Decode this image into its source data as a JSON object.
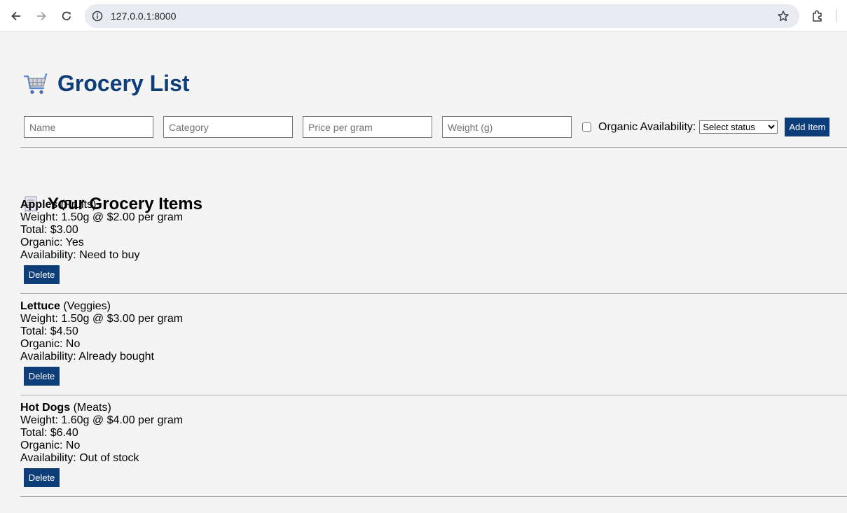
{
  "browser": {
    "url": "127.0.0.1:8000"
  },
  "page": {
    "title": "Grocery List",
    "form": {
      "name_placeholder": "Name",
      "category_placeholder": "Category",
      "price_placeholder": "Price per gram",
      "weight_placeholder": "Weight (g)",
      "organic_label": "Organic",
      "availability_label": "Availability:",
      "status_selected": "Select status",
      "add_button": "Add Item"
    },
    "list_title": "Your Grocery Items",
    "delete_label": "Delete",
    "items": [
      {
        "name": "Apples",
        "category": "(Fruits)",
        "weight_line": "Weight: 1.50g @ $2.00 per gram",
        "total_line": "Total: $3.00",
        "organic_line": "Organic: Yes",
        "availability_line": "Availability: Need to buy"
      },
      {
        "name": "Lettuce",
        "category": "(Veggies)",
        "weight_line": "Weight: 1.50g @ $3.00 per gram",
        "total_line": "Total: $4.50",
        "organic_line": "Organic: No",
        "availability_line": "Availability: Already bought"
      },
      {
        "name": "Hot Dogs",
        "category": "(Meats)",
        "weight_line": "Weight: 1.60g @ $4.00 per gram",
        "total_line": "Total: $6.40",
        "organic_line": "Organic: No",
        "availability_line": "Availability: Out of stock"
      }
    ]
  },
  "colors": {
    "accent": "#0d3e7a",
    "background": "#f4f4f4"
  },
  "icons": {
    "title": "shopping-cart-icon",
    "list": "receipt-icon"
  }
}
